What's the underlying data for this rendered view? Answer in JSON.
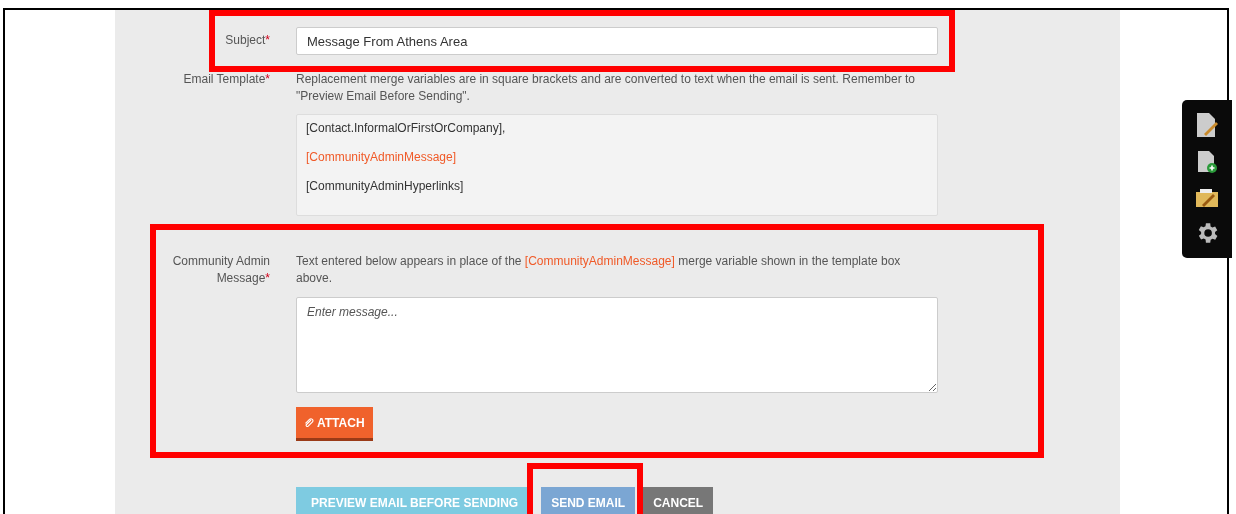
{
  "form": {
    "subject": {
      "label": "Subject",
      "required_mark": "*",
      "value": "Message From Athens Area"
    },
    "template": {
      "label": "Email Template",
      "required_mark": "*",
      "help": "Replacement merge variables are in square brackets and are converted to text when the email is sent. Remember to \"Preview Email Before Sending\".",
      "lines": [
        {
          "kind": "plain",
          "text": "[Contact.InformalOrFirstOrCompany],"
        },
        {
          "kind": "variable",
          "text": "[CommunityAdminMessage]"
        },
        {
          "kind": "plain",
          "text": "[CommunityAdminHyperlinks]"
        }
      ]
    },
    "message": {
      "label": "Community Admin Message",
      "required_mark": "*",
      "help": [
        {
          "kind": "plain",
          "text": "Text entered below appears in place of the "
        },
        {
          "kind": "variable",
          "text": "[CommunityAdminMessage]"
        },
        {
          "kind": "plain",
          "text": " merge variable shown in the template box above."
        }
      ],
      "placeholder": "Enter message...",
      "attach": "ATTACH"
    },
    "buttons": [
      {
        "kind": "preview",
        "label": "PREVIEW EMAIL BEFORE SENDING"
      },
      {
        "kind": "send",
        "label": "SEND EMAIL"
      },
      {
        "kind": "cancel",
        "label": "CANCEL"
      }
    ]
  },
  "highlights": [
    {
      "kind": "subject"
    },
    {
      "kind": "message"
    },
    {
      "kind": "send"
    }
  ],
  "toolbar": [
    {
      "kind": "edit-page"
    },
    {
      "kind": "add-page"
    },
    {
      "kind": "edit-folder"
    },
    {
      "kind": "settings"
    }
  ]
}
